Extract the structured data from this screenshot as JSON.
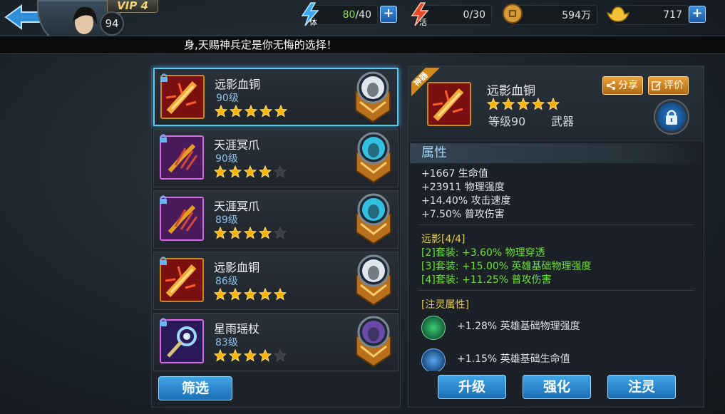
{
  "header": {
    "vip_label": "VIP 4",
    "player_level": "94",
    "stamina": {
      "current": "80",
      "max": "/40"
    },
    "activity": "0/30",
    "coins": "594万",
    "gold": "717"
  },
  "marquee_text": "身,天赐神兵定是你无悔的选择！",
  "equipment_list": [
    {
      "name": "远影血铜",
      "level": "90级",
      "stars": 5,
      "rarity": "orange",
      "selected": true,
      "hero": "white"
    },
    {
      "name": "天涯冥爪",
      "level": "90级",
      "stars": 4,
      "rarity": "purple",
      "selected": false,
      "hero": "teal"
    },
    {
      "name": "天涯冥爪",
      "level": "89级",
      "stars": 4,
      "rarity": "purple",
      "selected": false,
      "hero": "teal"
    },
    {
      "name": "远影血铜",
      "level": "86级",
      "stars": 5,
      "rarity": "orange",
      "selected": false,
      "hero": "white"
    },
    {
      "name": "星雨瑶杖",
      "level": "83级",
      "stars": 4,
      "rarity": "purple",
      "selected": false,
      "hero": "violet"
    }
  ],
  "filter_label": "筛选",
  "detail": {
    "ribbon": "神器",
    "name": "远影血铜",
    "stars": 5,
    "level": "等级90",
    "type": "武器",
    "share_label": "分享",
    "review_label": "评价",
    "attributes_title": "属性",
    "attributes": [
      "+1667 生命值",
      "+23911 物理强度",
      "+14.40% 攻击速度",
      "+7.50% 普攻伤害"
    ],
    "set_title": "远影[4/4]",
    "set_bonuses": [
      "[2]套装: +3.60% 物理穿透",
      "[3]套装: +15.00% 英雄基础物理强度",
      "[4]套装: +11.25% 普攻伤害"
    ],
    "soul_title": "[注灵属性]",
    "soul_attrs": [
      "+1.28% 英雄基础物理强度",
      "+1.15% 英雄基础生命值"
    ]
  },
  "actions": {
    "upgrade": "升级",
    "enhance": "强化",
    "infuse": "注灵"
  },
  "colors": {
    "accent_blue": "#3ea6e6",
    "set_green": "#6ee03a",
    "set_gold": "#e6c84a",
    "star_gold": "#ffb400"
  }
}
